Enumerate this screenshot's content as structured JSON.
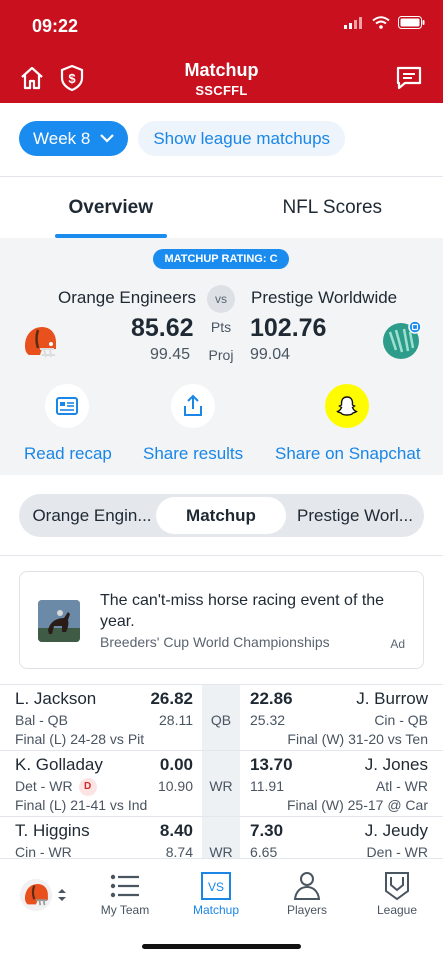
{
  "status": {
    "time": "09:22"
  },
  "header": {
    "title": "Matchup",
    "subtitle": "SSCFFL"
  },
  "week": {
    "label": "Week 8",
    "league_matchups": "Show league matchups"
  },
  "tabs": [
    "Overview",
    "NFL Scores"
  ],
  "overview": {
    "rating": "MATCHUP RATING: C",
    "vs": "vs",
    "pts_label": "Pts",
    "proj_label": "Proj",
    "left_team": {
      "name": "Orange Engineers",
      "score": "85.62",
      "proj": "99.45"
    },
    "right_team": {
      "name": "Prestige Worldwide",
      "score": "102.76",
      "proj": "99.04"
    },
    "actions": [
      "Read recap",
      "Share results",
      "Share on Snapchat"
    ]
  },
  "segments": [
    "Orange Engin...",
    "Matchup",
    "Prestige Worl..."
  ],
  "ad": {
    "title": "The can't-miss horse racing event of the year.",
    "sponsor": "Breeders' Cup World Championships",
    "tag": "Ad"
  },
  "rows": [
    {
      "pos": "QB",
      "left": {
        "name": "L. Jackson",
        "pts": "26.82",
        "team": "Bal - QB",
        "proj": "28.11",
        "game": "Final (L) 24-28 vs Pit"
      },
      "right": {
        "name": "J. Burrow",
        "pts": "22.86",
        "team": "Cin - QB",
        "proj": "25.32",
        "game": "Final (W) 31-20 vs Ten"
      }
    },
    {
      "pos": "WR",
      "left": {
        "name": "K. Golladay",
        "pts": "0.00",
        "team": "Det - WR",
        "badge": "D",
        "proj": "10.90",
        "game": "Final (L) 21-41 vs Ind"
      },
      "right": {
        "name": "J. Jones",
        "pts": "13.70",
        "team": "Atl - WR",
        "proj": "11.91",
        "game": "Final (W) 25-17 @ Car"
      }
    },
    {
      "pos": "WR",
      "left": {
        "name": "T. Higgins",
        "pts": "8.40",
        "team": "Cin - WR",
        "proj": "8.74",
        "game": ""
      },
      "right": {
        "name": "J. Jeudy",
        "pts": "7.30",
        "team": "Den - WR",
        "proj": "6.65",
        "game": ""
      }
    }
  ],
  "bottom_nav": [
    "My Team",
    "Matchup",
    "Players",
    "League"
  ],
  "colors": {
    "brand_red": "#c8101e",
    "accent_blue": "#1a8cf0",
    "snapchat_yellow": "#fffc00"
  }
}
